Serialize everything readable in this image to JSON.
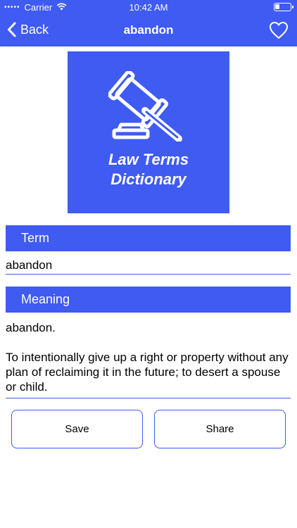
{
  "status_bar": {
    "carrier": "Carrier",
    "time": "10:42 AM"
  },
  "nav": {
    "back_label": "Back",
    "title": "abandon"
  },
  "logo": {
    "line1": "Law Terms",
    "line2": "Dictionary"
  },
  "term": {
    "header": "Term",
    "value": "abandon"
  },
  "meaning": {
    "header": "Meaning",
    "paragraphs": [
      "abandon.",
      "To intentionally give up a right or property without any plan of reclaiming it in the future; to desert a spouse or child."
    ]
  },
  "buttons": {
    "save": "Save",
    "share": "Share"
  },
  "colors": {
    "accent": "#3f5bf2",
    "background": "#ffffff"
  }
}
